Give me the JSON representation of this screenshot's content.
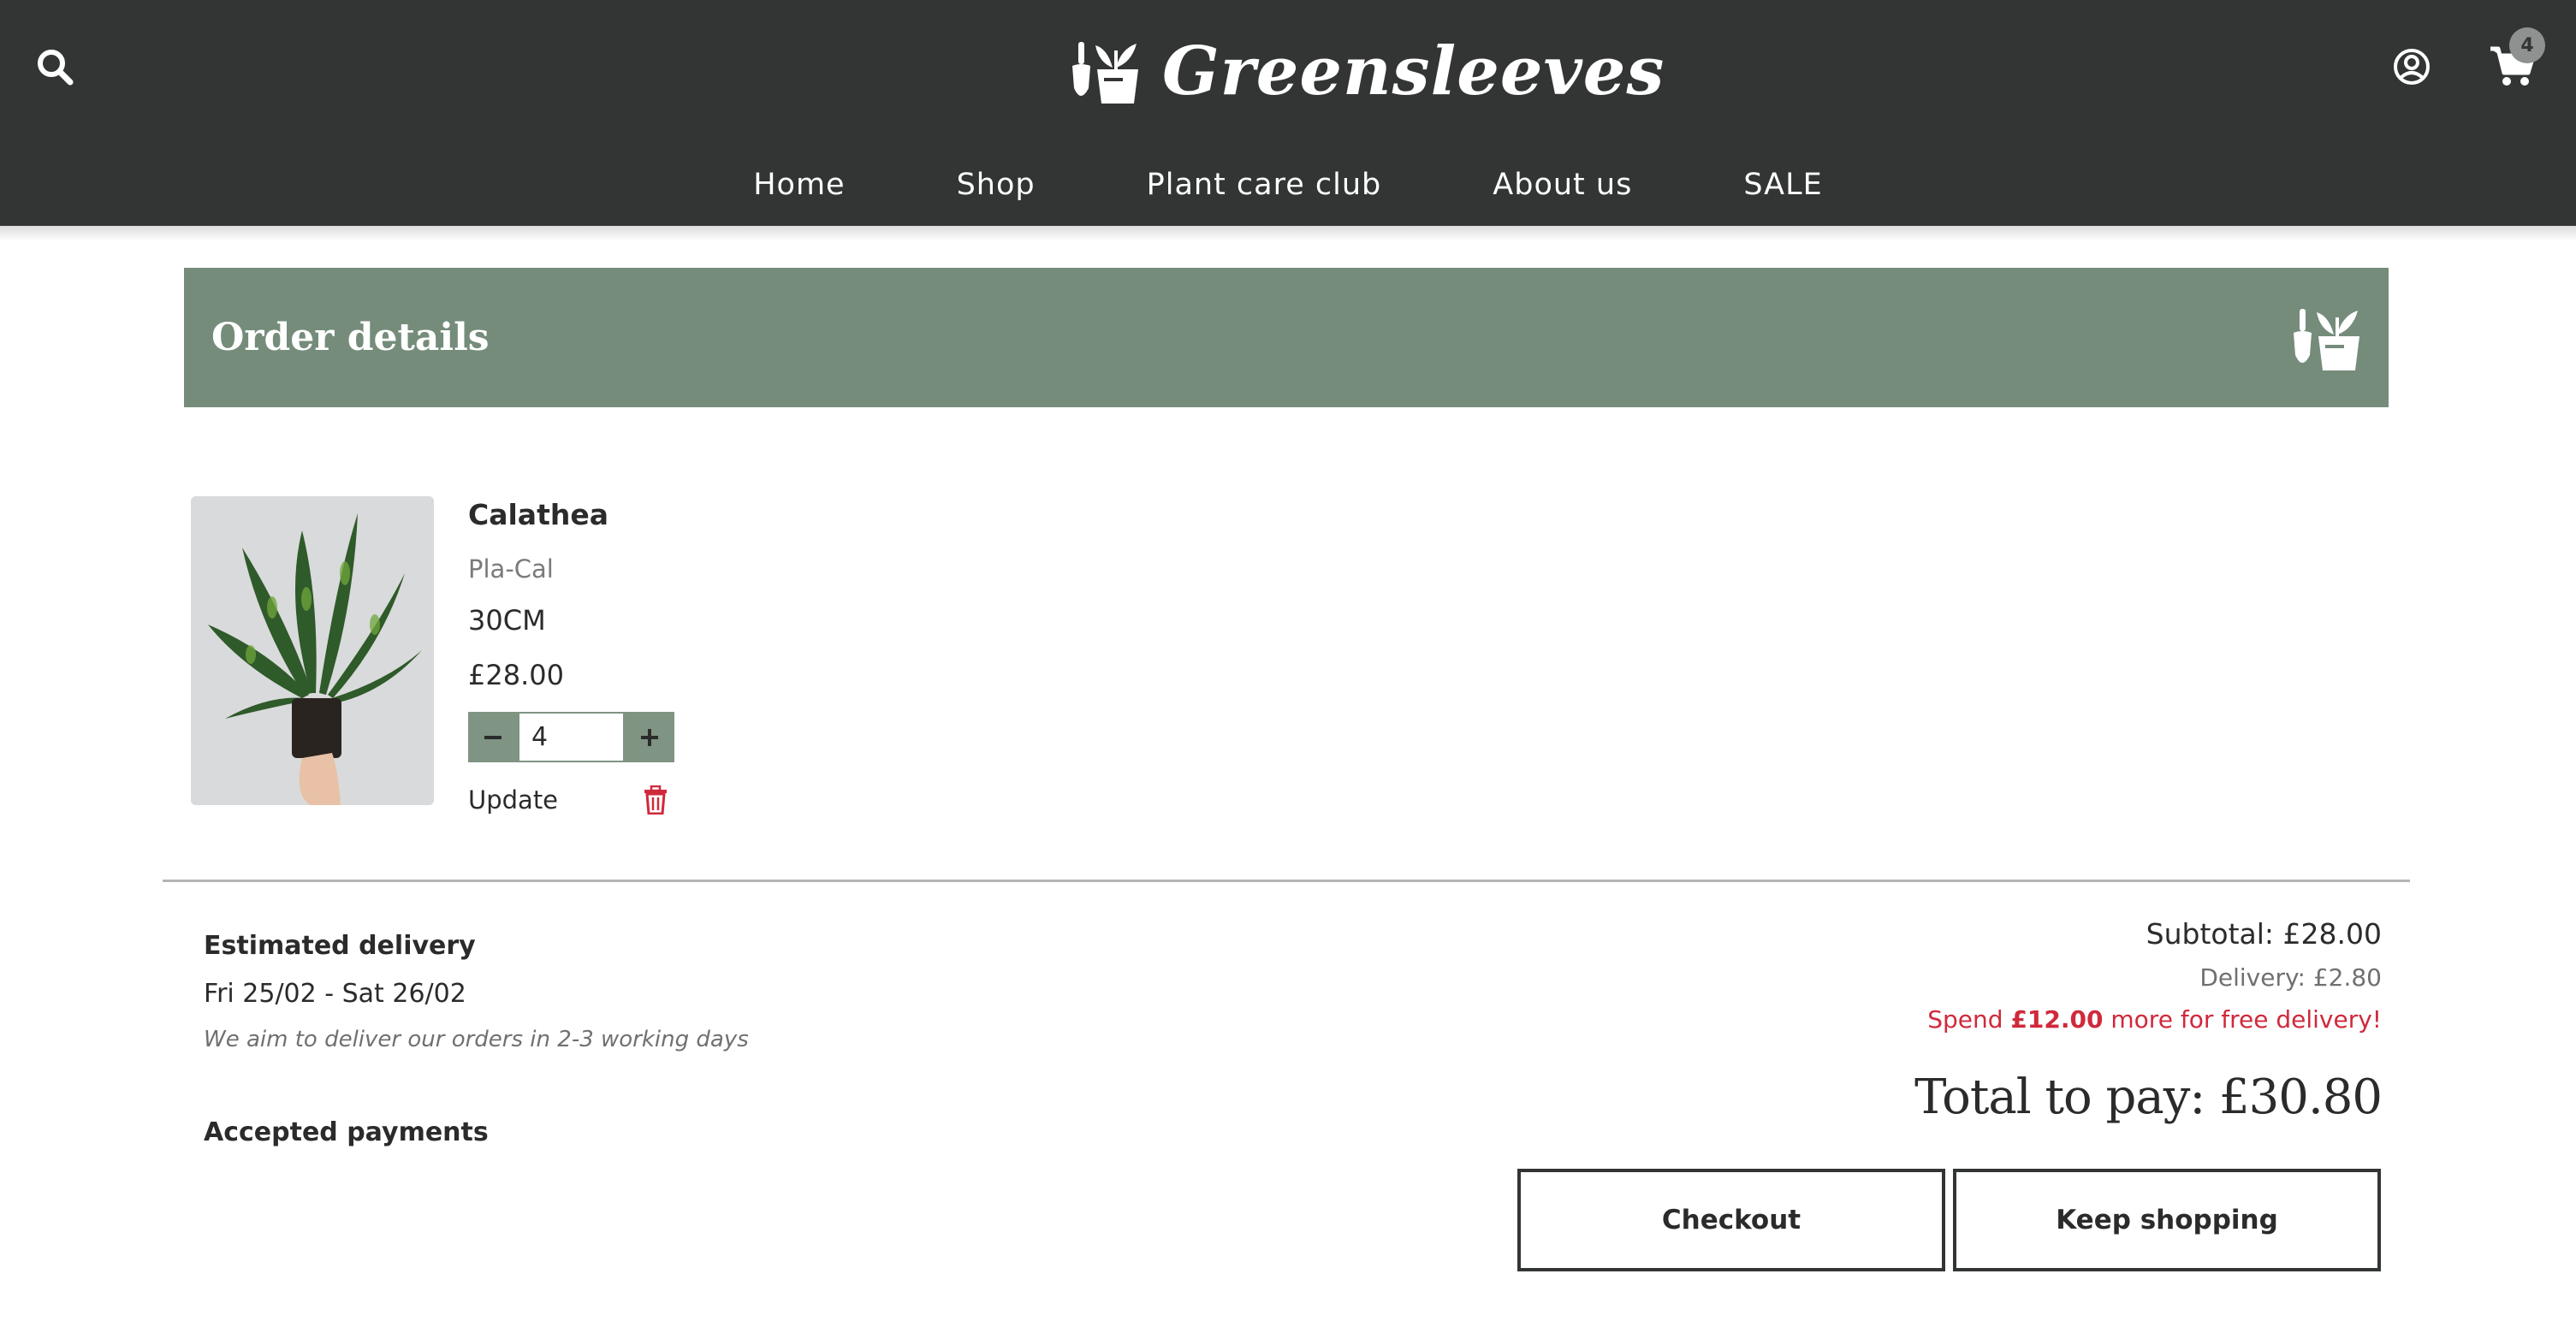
{
  "header": {
    "brand": "Greensleeves",
    "cart_count": "4",
    "nav": [
      "Home",
      "Shop",
      "Plant care club",
      "About us",
      "SALE"
    ],
    "icons": {
      "search": "search-icon",
      "account": "account-icon",
      "cart": "cart-icon",
      "logo": "trowel-plant-logo"
    }
  },
  "order": {
    "title": "Order details"
  },
  "item": {
    "name": "Calathea",
    "sku": "Pla-Cal",
    "size": "30CM",
    "price": "£28.00",
    "quantity": "4",
    "update_label": "Update",
    "icons": {
      "decrease": "minus-icon",
      "increase": "plus-icon",
      "delete": "trash-icon"
    }
  },
  "delivery": {
    "title": "Estimated delivery",
    "dates": "Fri 25/02 - Sat 26/02",
    "note": "We aim to deliver our orders in 2-3 working days"
  },
  "payments": {
    "title": "Accepted payments"
  },
  "totals": {
    "subtotal": "Subtotal: £28.00",
    "delivery": "Delivery: £2.80",
    "spend_prefix": "Spend ",
    "spend_amount": "£12.00",
    "spend_suffix": " more for free delivery!",
    "total": "Total to pay: £30.80"
  },
  "actions": {
    "checkout": "Checkout",
    "keep_shopping": "Keep shopping"
  },
  "colors": {
    "header_bg": "#323534",
    "banner_bg": "#758c7b",
    "accent_red": "#d0293b",
    "qty_btn": "#7f9482"
  }
}
